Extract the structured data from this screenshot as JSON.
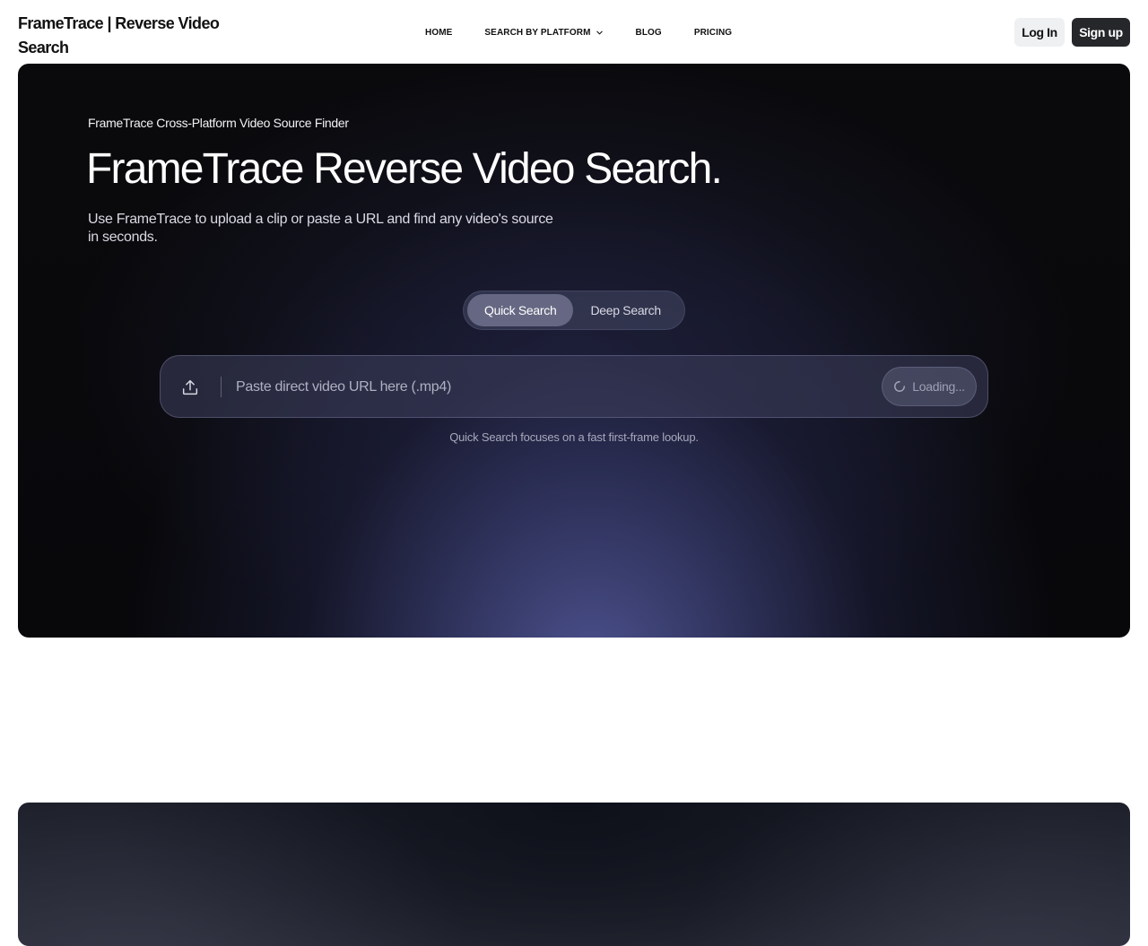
{
  "header": {
    "brand": "FrameTrace | Reverse Video Search",
    "nav": [
      {
        "label": "HOME"
      },
      {
        "label": "SEARCH BY PLATFORM",
        "has_dropdown": true
      },
      {
        "label": "BLOG"
      },
      {
        "label": "PRICING"
      }
    ],
    "login_label": "Log In",
    "signup_label": "Sign up"
  },
  "hero": {
    "eyebrow": "FrameTrace Cross-Platform Video Source Finder",
    "title": "FrameTrace Reverse Video Search.",
    "subtitle": "Use FrameTrace to upload a clip or paste a URL and find any video's source in seconds.",
    "modes": [
      {
        "label": "Quick Search",
        "active": true
      },
      {
        "label": "Deep Search",
        "active": false
      }
    ],
    "search": {
      "placeholder": "Paste direct video URL here (.mp4)",
      "value": "",
      "upload_icon": "upload-icon",
      "button_label": "Loading...",
      "button_icon": "spinner-icon"
    },
    "hint": "Quick Search focuses on a fast first-frame lookup."
  },
  "colors": {
    "signup_bg": "#25272b",
    "login_bg": "#eef0f2",
    "hero_bg": "#08080b",
    "hero_glow": "#50569a"
  }
}
